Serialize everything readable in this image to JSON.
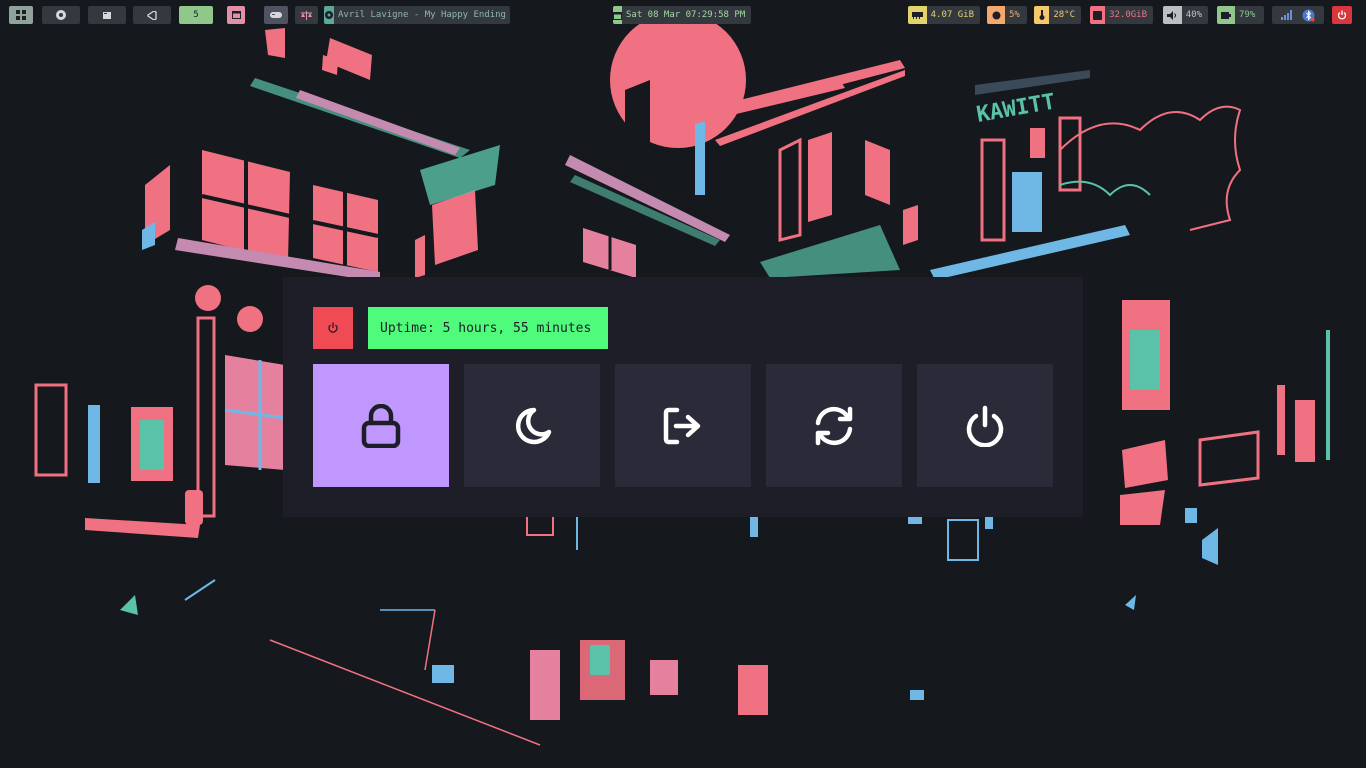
{
  "topbar": {
    "workspace_number": "5",
    "now_playing": "Avril Lavigne - My Happy Ending",
    "datetime": "Sat 08 Mar 07:29:58 PM",
    "memory": "4.07 GiB",
    "cpu": "5%",
    "temperature": "28°C",
    "disk": "32.0GiB",
    "volume": "40%",
    "battery": "79%"
  },
  "wallpaper": {
    "sign_text": "KAWITT"
  },
  "powermenu": {
    "uptime": "Uptime: 5 hours, 55 minutes",
    "options": [
      {
        "id": "lock",
        "icon": "lock-icon",
        "selected": true
      },
      {
        "id": "suspend",
        "icon": "moon-icon",
        "selected": false
      },
      {
        "id": "logout",
        "icon": "logout-icon",
        "selected": false
      },
      {
        "id": "reboot",
        "icon": "reboot-icon",
        "selected": false
      },
      {
        "id": "shutdown",
        "icon": "power-icon",
        "selected": false
      }
    ]
  },
  "colors": {
    "background": "#15181c",
    "panel": "#1e1e29",
    "option": "#2a2a38",
    "selected": "#c097ff",
    "uptime": "#4efb7a",
    "power": "#f04a54",
    "pink": "#f07182",
    "teal": "#5ac2a8",
    "blue": "#6fb8e6"
  }
}
